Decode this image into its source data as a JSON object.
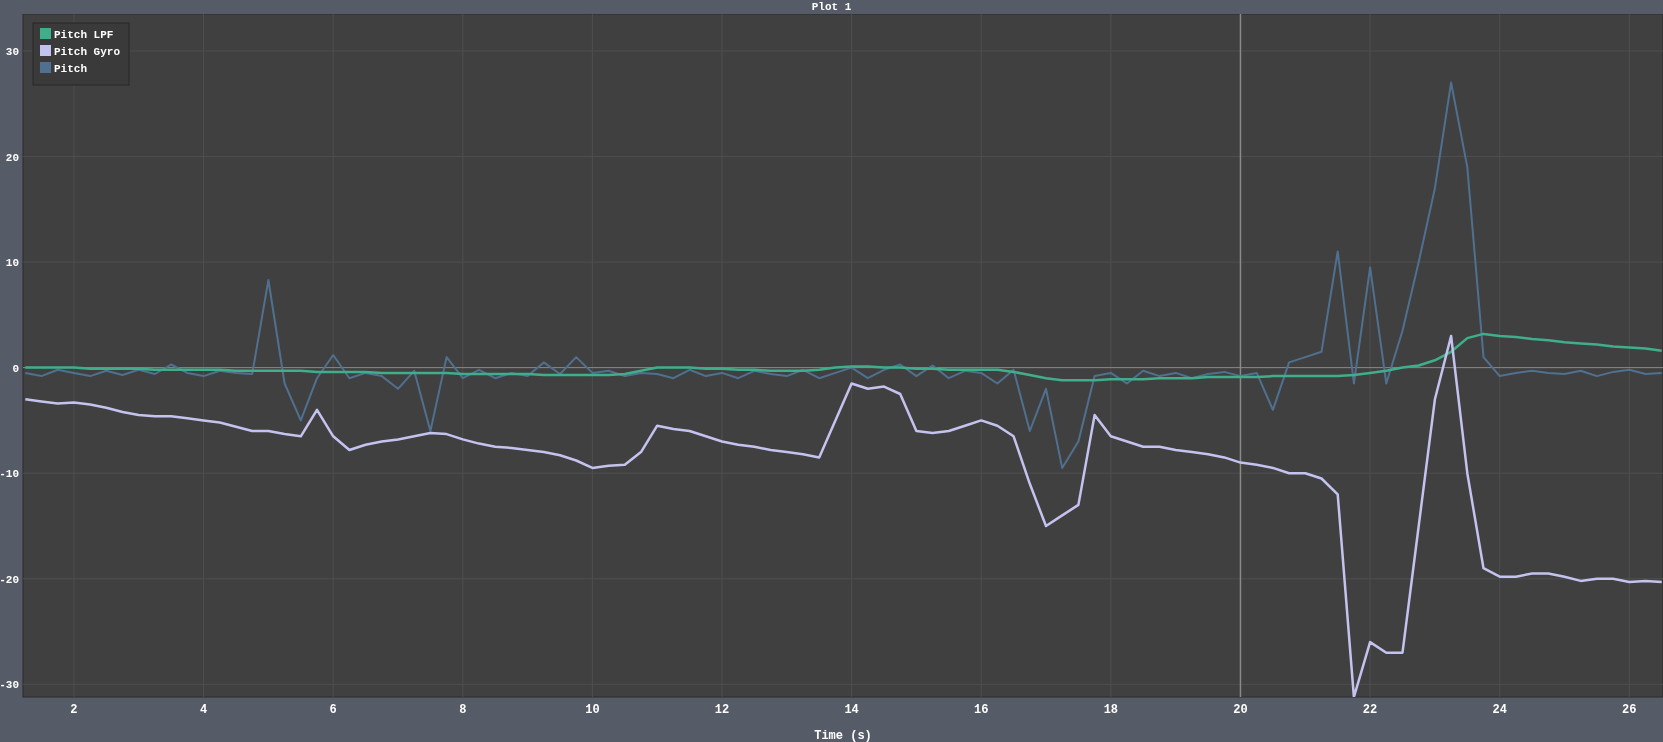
{
  "plot": {
    "chart_data": {
      "type": "line",
      "title": "Plot 1",
      "xlabel": "Time (s)",
      "grid": true,
      "legend": true,
      "x": [
        1.25,
        1.5,
        1.75,
        2,
        2.25,
        2.5,
        2.75,
        3,
        3.25,
        3.5,
        3.75,
        4,
        4.25,
        4.5,
        4.75,
        5,
        5.25,
        5.5,
        5.75,
        6,
        6.25,
        6.5,
        6.75,
        7,
        7.25,
        7.5,
        7.75,
        8,
        8.25,
        8.5,
        8.75,
        9,
        9.25,
        9.5,
        9.75,
        10,
        10.25,
        10.5,
        10.75,
        11,
        11.25,
        11.5,
        11.75,
        12,
        12.25,
        12.5,
        12.75,
        13,
        13.25,
        13.5,
        13.75,
        14,
        14.25,
        14.5,
        14.75,
        15,
        15.25,
        15.5,
        15.75,
        16,
        16.25,
        16.5,
        16.75,
        17,
        17.25,
        17.5,
        17.75,
        18,
        18.25,
        18.5,
        18.75,
        19,
        19.25,
        19.5,
        19.75,
        20,
        20.25,
        20.5,
        20.75,
        21,
        21.25,
        21.5,
        21.75,
        22,
        22.25,
        22.5,
        22.75,
        23,
        23.25,
        23.5,
        23.75,
        24,
        24.25,
        24.5,
        24.75,
        25,
        25.25,
        25.5,
        25.75,
        26,
        26.25,
        26.5
      ],
      "series": [
        {
          "name": "Pitch LPF",
          "color": "#3fae8b",
          "values": [
            0,
            0,
            0,
            0,
            -0.1,
            -0.1,
            -0.1,
            -0.1,
            -0.2,
            -0.2,
            -0.2,
            -0.2,
            -0.2,
            -0.3,
            -0.3,
            -0.3,
            -0.3,
            -0.3,
            -0.4,
            -0.4,
            -0.4,
            -0.4,
            -0.5,
            -0.5,
            -0.5,
            -0.5,
            -0.5,
            -0.6,
            -0.6,
            -0.6,
            -0.6,
            -0.6,
            -0.7,
            -0.7,
            -0.7,
            -0.7,
            -0.7,
            -0.6,
            -0.3,
            0,
            0,
            0,
            -0.1,
            -0.1,
            -0.2,
            -0.2,
            -0.3,
            -0.3,
            -0.3,
            -0.2,
            0,
            0.1,
            0.1,
            0,
            0,
            -0.1,
            -0.1,
            -0.2,
            -0.2,
            -0.2,
            -0.2,
            -0.4,
            -0.7,
            -1,
            -1.2,
            -1.2,
            -1.2,
            -1.1,
            -1.1,
            -1.1,
            -1,
            -1,
            -1,
            -0.9,
            -0.9,
            -0.9,
            -0.9,
            -0.8,
            -0.8,
            -0.8,
            -0.8,
            -0.8,
            -0.7,
            -0.5,
            -0.3,
            0,
            0.2,
            0.7,
            1.5,
            2.8,
            3.2,
            3,
            2.9,
            2.7,
            2.6,
            2.4,
            2.3,
            2.2,
            2,
            1.9,
            1.8,
            1.6
          ]
        },
        {
          "name": "Pitch Gyro",
          "color": "#c4c3f0",
          "values": [
            -3,
            -3.2,
            -3.4,
            -3.3,
            -3.5,
            -3.8,
            -4.2,
            -4.5,
            -4.6,
            -4.6,
            -4.8,
            -5,
            -5.2,
            -5.6,
            -6,
            -6,
            -6.3,
            -6.5,
            -4,
            -6.5,
            -7.8,
            -7.3,
            -7,
            -6.8,
            -6.5,
            -6.2,
            -6.3,
            -6.8,
            -7.2,
            -7.5,
            -7.6,
            -7.8,
            -8,
            -8.3,
            -8.8,
            -9.5,
            -9.3,
            -9.2,
            -8,
            -5.5,
            -5.8,
            -6,
            -6.5,
            -7,
            -7.3,
            -7.5,
            -7.8,
            -8,
            -8.2,
            -8.5,
            -5,
            -1.5,
            -2,
            -1.8,
            -2.5,
            -6,
            -6.2,
            -6,
            -5.5,
            -5,
            -5.5,
            -6.5,
            -11,
            -15,
            -14,
            -13,
            -4.5,
            -6.5,
            -7,
            -7.5,
            -7.5,
            -7.8,
            -8,
            -8.2,
            -8.5,
            -9,
            -9.2,
            -9.5,
            -10,
            -10,
            -10.5,
            -12,
            -31.2,
            -26,
            -27,
            -27,
            -15,
            -3,
            3,
            -10,
            -19,
            -19.8,
            -19.8,
            -19.5,
            -19.5,
            -19.8,
            -20.2,
            -20,
            -20,
            -20.3,
            -20.2,
            -20.3
          ]
        },
        {
          "name": "Pitch",
          "color": "#50708f",
          "values": [
            -0.5,
            -0.8,
            -0.2,
            -0.5,
            -0.8,
            -0.3,
            -0.7,
            -0.2,
            -0.6,
            0.3,
            -0.5,
            -0.8,
            -0.3,
            -0.5,
            -0.6,
            8.3,
            -1.5,
            -5,
            -1,
            1.2,
            -1,
            -0.5,
            -0.8,
            -2,
            -0.3,
            -6,
            1,
            -1,
            -0.2,
            -1,
            -0.5,
            -0.8,
            0.5,
            -0.6,
            1,
            -0.5,
            -0.3,
            -0.8,
            -0.5,
            -0.6,
            -1,
            -0.2,
            -0.8,
            -0.5,
            -1,
            -0.3,
            -0.6,
            -0.8,
            -0.2,
            -1,
            -0.5,
            0,
            -1,
            -0.2,
            0.3,
            -0.8,
            0.2,
            -1,
            -0.3,
            -0.5,
            -1.5,
            -0.2,
            -6,
            -2,
            -9.5,
            -7,
            -0.8,
            -0.5,
            -1.5,
            -0.3,
            -0.8,
            -0.5,
            -1,
            -0.6,
            -0.4,
            -0.8,
            -0.5,
            -4,
            0.5,
            1,
            1.5,
            11,
            -1.5,
            9.5,
            -1.5,
            3.5,
            10,
            17,
            27,
            19,
            1,
            -0.8,
            -0.5,
            -0.3,
            -0.5,
            -0.6,
            -0.3,
            -0.8,
            -0.4,
            -0.2,
            -0.6,
            -0.5
          ]
        }
      ],
      "xlim": [
        1.214,
        26.52
      ],
      "ylim": [
        -31.2,
        33.5
      ],
      "xticks": [
        2,
        4,
        6,
        8,
        10,
        12,
        14,
        16,
        18,
        20,
        22,
        24,
        26
      ],
      "yticks": [
        -30,
        -20,
        -10,
        0,
        10,
        20,
        30
      ],
      "ref_lines": [
        {
          "axis": "x",
          "value": 20
        }
      ]
    }
  }
}
